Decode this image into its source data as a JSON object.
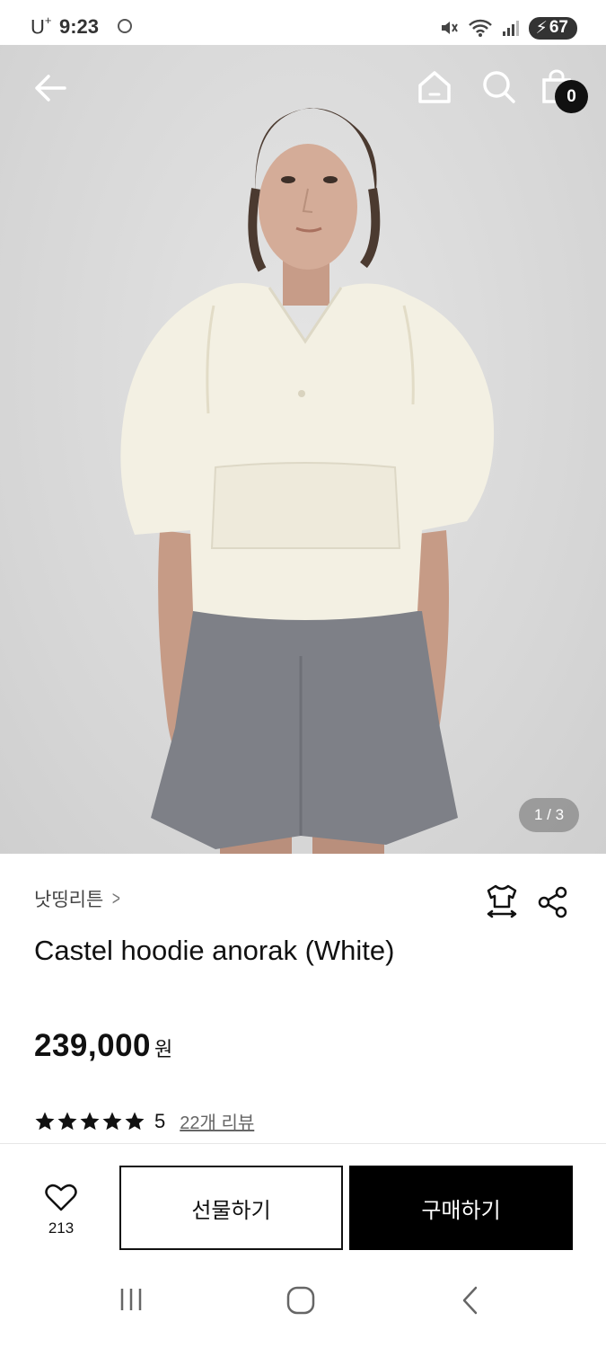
{
  "status_bar": {
    "carrier": "U",
    "carrier_sup": "+",
    "time": "9:23",
    "battery": "67"
  },
  "hero": {
    "cart_count": "0",
    "page_indicator": "1 / 3",
    "icons": [
      "back-arrow-icon",
      "home-icon",
      "search-icon",
      "shopping-bag-icon"
    ]
  },
  "product": {
    "brand": "낫띵리튼",
    "name": "Castel hoodie anorak (White)",
    "price": "239,000",
    "currency": "원",
    "rating": "5",
    "star_count": 5,
    "reviews_link": "22개 리뷰"
  },
  "actions": {
    "like_count": "213",
    "gift_label": "선물하기",
    "buy_label": "구매하기"
  },
  "colors": {
    "accent": "#000000",
    "text": "#111111",
    "muted": "#666666"
  }
}
